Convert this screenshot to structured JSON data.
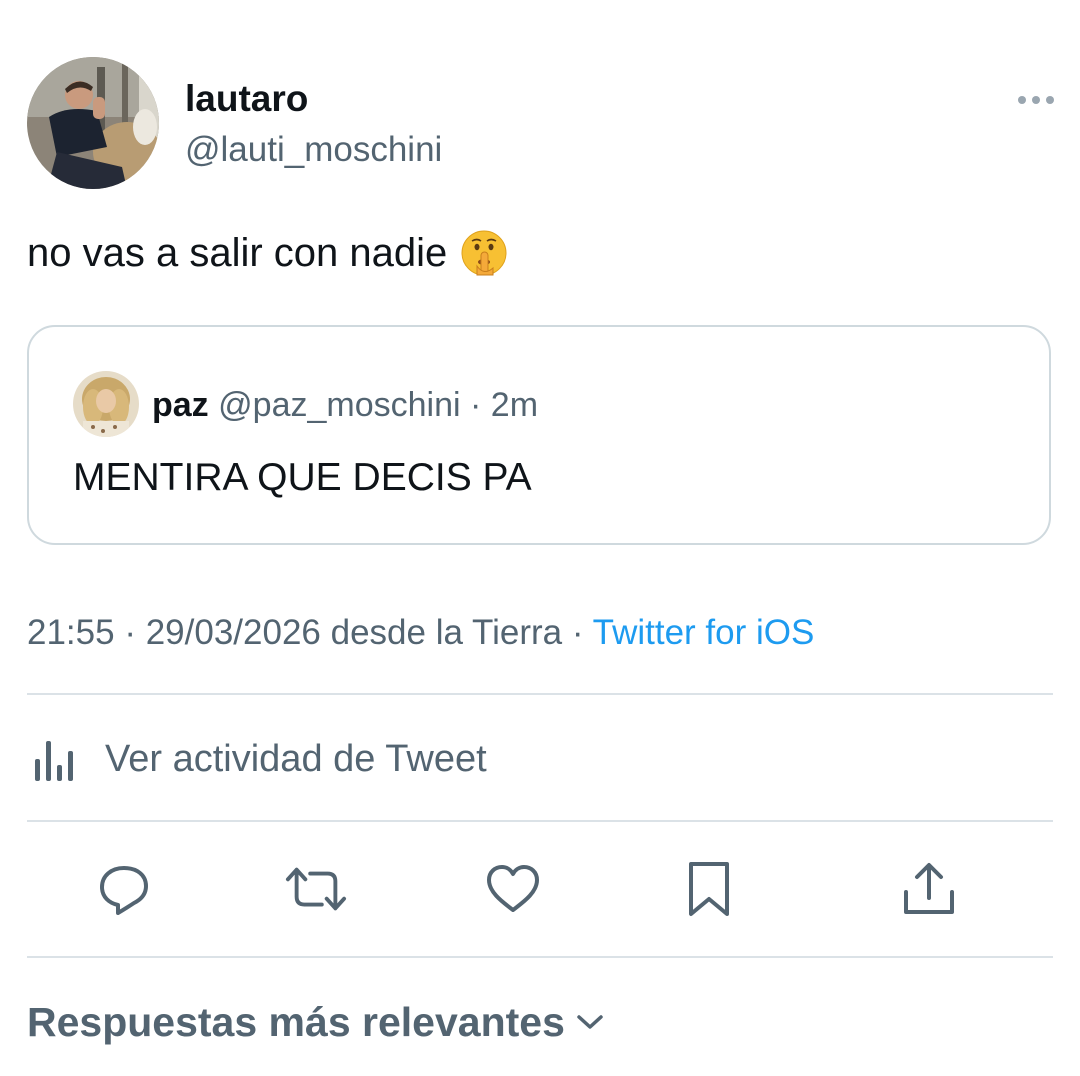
{
  "tweet": {
    "author": {
      "display_name": "lautaro",
      "handle": "@lauti_moschini",
      "avatar_icon": "profile-photo"
    },
    "more_icon": "more-horizontal-icon",
    "text": "no vas a salir con nadie",
    "emoji": "shushing-face"
  },
  "quoted_tweet": {
    "display_name": "paz",
    "handle": "@paz_moschini",
    "separator": "·",
    "time_ago": "2m",
    "text": "MENTIRA QUE DECIS PA"
  },
  "meta": {
    "time": "21:55",
    "separator": "·",
    "date_location": "29/03/2026 desde la Tierra",
    "source": "Twitter for iOS"
  },
  "activity": {
    "icon": "analytics-icon",
    "label": "Ver actividad de Tweet"
  },
  "actions": [
    {
      "name": "reply",
      "icon": "reply-bubble-icon"
    },
    {
      "name": "retweet",
      "icon": "retweet-icon"
    },
    {
      "name": "like",
      "icon": "heart-icon"
    },
    {
      "name": "bookmark",
      "icon": "bookmark-icon"
    },
    {
      "name": "share",
      "icon": "share-icon"
    }
  ],
  "replies": {
    "label": "Respuestas más relevantes",
    "icon": "chevron-down-icon"
  },
  "colors": {
    "text_primary": "#0f1419",
    "text_secondary": "#536471",
    "link": "#1d9bf0",
    "border": "#cfd9de"
  }
}
